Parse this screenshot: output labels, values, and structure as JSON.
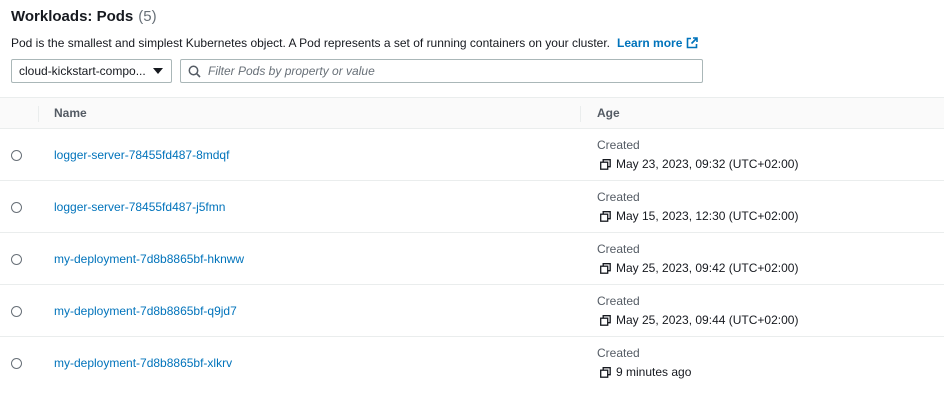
{
  "header": {
    "title": "Workloads: Pods",
    "count": "(5)",
    "description": "Pod is the smallest and simplest Kubernetes object. A Pod represents a set of running containers on your cluster.",
    "learn_more": "Learn more"
  },
  "namespace_select": {
    "value": "cloud-kickstart-compo..."
  },
  "filter": {
    "placeholder": "Filter Pods by property or value"
  },
  "table": {
    "columns": {
      "name": "Name",
      "age": "Age"
    },
    "rows": [
      {
        "name": "logger-server-78455fd487-8mdqf",
        "created_label": "Created",
        "age": "May 23, 2023, 09:32 (UTC+02:00)"
      },
      {
        "name": "logger-server-78455fd487-j5fmn",
        "created_label": "Created",
        "age": "May 15, 2023, 12:30 (UTC+02:00)"
      },
      {
        "name": "my-deployment-7d8b8865bf-hknww",
        "created_label": "Created",
        "age": "May 25, 2023, 09:42 (UTC+02:00)"
      },
      {
        "name": "my-deployment-7d8b8865bf-q9jd7",
        "created_label": "Created",
        "age": "May 25, 2023, 09:44 (UTC+02:00)"
      },
      {
        "name": "my-deployment-7d8b8865bf-xlkrv",
        "created_label": "Created",
        "age": "9 minutes ago"
      }
    ]
  },
  "icons": {
    "external_link": "external-link-icon",
    "search": "search-icon",
    "dropdown": "caret-down-icon",
    "copy": "copy-icon"
  },
  "colors": {
    "link": "#0073bb",
    "text": "#16191f",
    "muted": "#687078",
    "border": "#aab7b8"
  }
}
